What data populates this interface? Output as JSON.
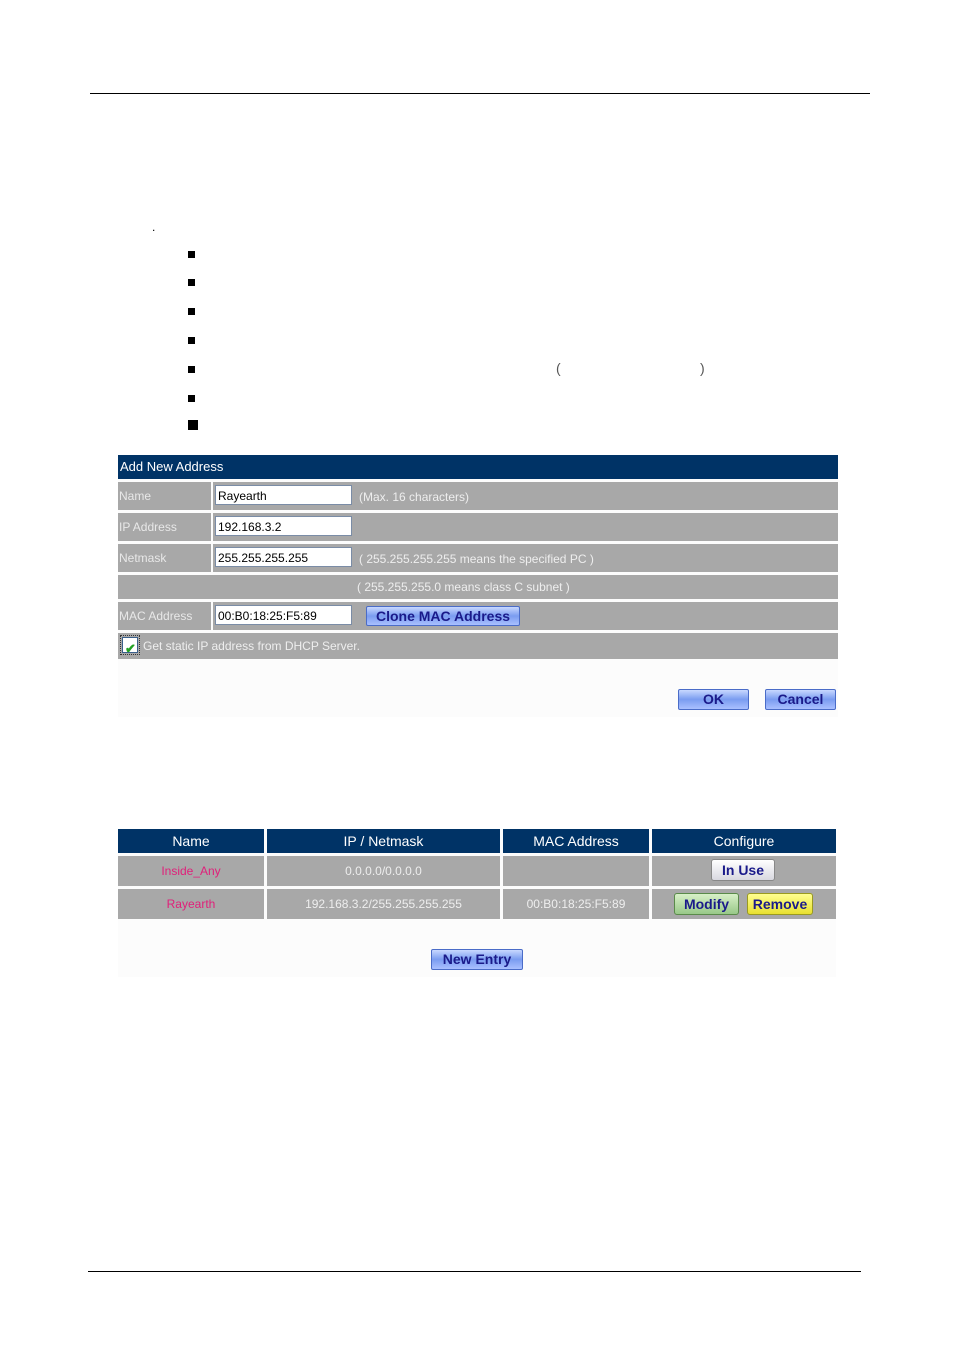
{
  "decor": {
    "list_dot": ".",
    "paren_open": "(",
    "paren_close": ")"
  },
  "bullets": {
    "count": 7
  },
  "add_form": {
    "title": "Add New Address",
    "fields": {
      "name": {
        "label": "Name",
        "value": "Rayearth",
        "hint": "(Max. 16 characters)"
      },
      "ip": {
        "label": "IP Address",
        "value": "192.168.3.2"
      },
      "netmask": {
        "label": "Netmask",
        "value": "255.255.255.255",
        "hint": "( 255.255.255.255 means the specified PC )",
        "hint2": "( 255.255.255.0 means class C subnet )"
      },
      "mac": {
        "label": "MAC Address",
        "value": "00:B0:18:25:F5:89",
        "clone_button": "Clone MAC Address"
      }
    },
    "dhcp_checkbox": {
      "checked": true,
      "label": "Get static IP address from DHCP Server."
    },
    "ok_button": "OK",
    "cancel_button": "Cancel"
  },
  "address_table": {
    "columns": [
      "Name",
      "IP / Netmask",
      "MAC Address",
      "Configure"
    ],
    "rows": [
      {
        "name": "Inside_Any",
        "ip_netmask": "0.0.0.0/0.0.0.0",
        "mac": "",
        "actions": [
          "In Use"
        ]
      },
      {
        "name": "Rayearth",
        "ip_netmask": "192.168.3.2/255.255.255.255",
        "mac": "00:B0:18:25:F5:89",
        "actions": [
          "Modify",
          "Remove"
        ]
      }
    ],
    "new_entry_button": "New Entry"
  },
  "colors": {
    "header_bg": "#003366",
    "row_bg": "#a8a8a8",
    "name_link": "#e0207a",
    "button_text": "#1a1a8a"
  }
}
